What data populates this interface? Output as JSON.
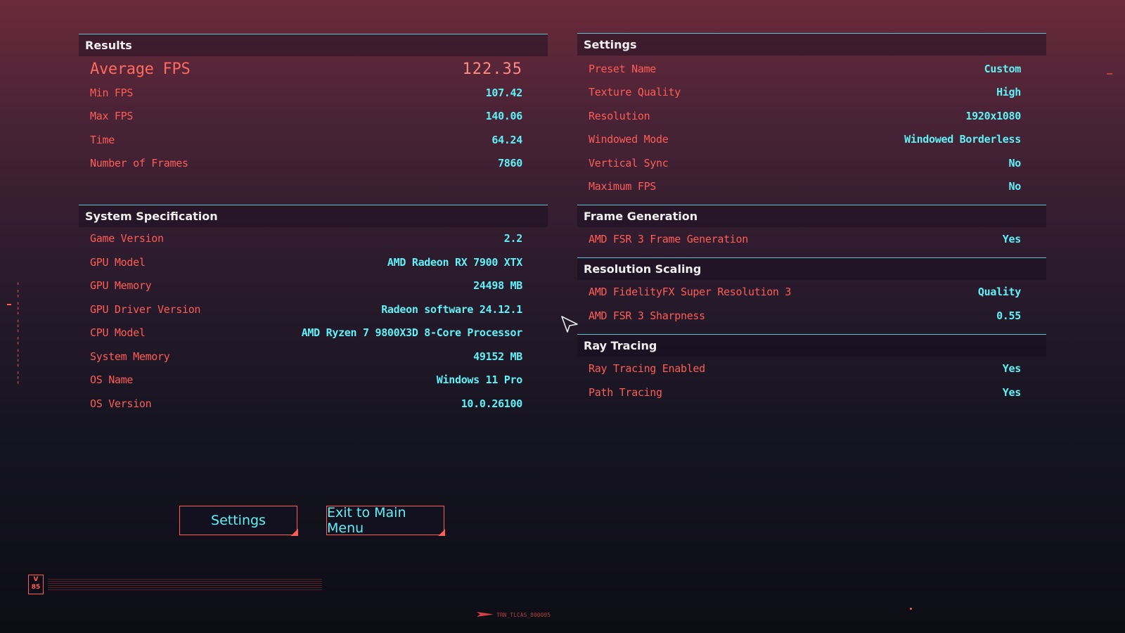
{
  "results": {
    "title": "Results",
    "rows": [
      {
        "label": "Average FPS",
        "value": "122.35"
      },
      {
        "label": "Min FPS",
        "value": "107.42"
      },
      {
        "label": "Max FPS",
        "value": "140.06"
      },
      {
        "label": "Time",
        "value": "64.24"
      },
      {
        "label": "Number of Frames",
        "value": "7860"
      }
    ]
  },
  "system": {
    "title": "System Specification",
    "rows": [
      {
        "label": "Game Version",
        "value": "2.2"
      },
      {
        "label": "GPU Model",
        "value": "AMD Radeon RX 7900 XTX"
      },
      {
        "label": "GPU Memory",
        "value": "24498 MB"
      },
      {
        "label": "GPU Driver Version",
        "value": "Radeon software 24.12.1"
      },
      {
        "label": "CPU Model",
        "value": "AMD Ryzen 7 9800X3D 8-Core Processor"
      },
      {
        "label": "System Memory",
        "value": "49152 MB"
      },
      {
        "label": "OS Name",
        "value": "Windows 11 Pro"
      },
      {
        "label": "OS Version",
        "value": "10.0.26100"
      }
    ]
  },
  "settings": {
    "title": "Settings",
    "rows": [
      {
        "label": "Preset Name",
        "value": "Custom"
      },
      {
        "label": "Texture Quality",
        "value": "High"
      },
      {
        "label": "Resolution",
        "value": "1920x1080"
      },
      {
        "label": "Windowed Mode",
        "value": "Windowed Borderless"
      },
      {
        "label": "Vertical Sync",
        "value": "No"
      },
      {
        "label": "Maximum FPS",
        "value": "No"
      }
    ]
  },
  "frame_generation": {
    "title": "Frame Generation",
    "rows": [
      {
        "label": "AMD FSR 3 Frame Generation",
        "value": "Yes"
      }
    ]
  },
  "resolution_scaling": {
    "title": "Resolution Scaling",
    "rows": [
      {
        "label": "AMD FidelityFX Super Resolution 3",
        "value": "Quality"
      },
      {
        "label": "AMD FSR 3 Sharpness",
        "value": "0.55"
      }
    ]
  },
  "ray_tracing": {
    "title": "Ray Tracing",
    "rows": [
      {
        "label": "Ray Tracing Enabled",
        "value": "Yes"
      },
      {
        "label": "Path Tracing",
        "value": "Yes"
      }
    ]
  },
  "buttons": {
    "settings_label": "Settings",
    "exit_label": "Exit to Main Menu"
  },
  "footer": {
    "logo_text": "V 85",
    "build_tag": "TRN_TLCAS_800095"
  },
  "colors": {
    "label": "#ff5c56",
    "value": "#5ef2f7",
    "header_line": "#5fc3cc"
  },
  "icons": {
    "cursor": "cursor-arrow-icon",
    "logo": "v85-logo-icon"
  }
}
